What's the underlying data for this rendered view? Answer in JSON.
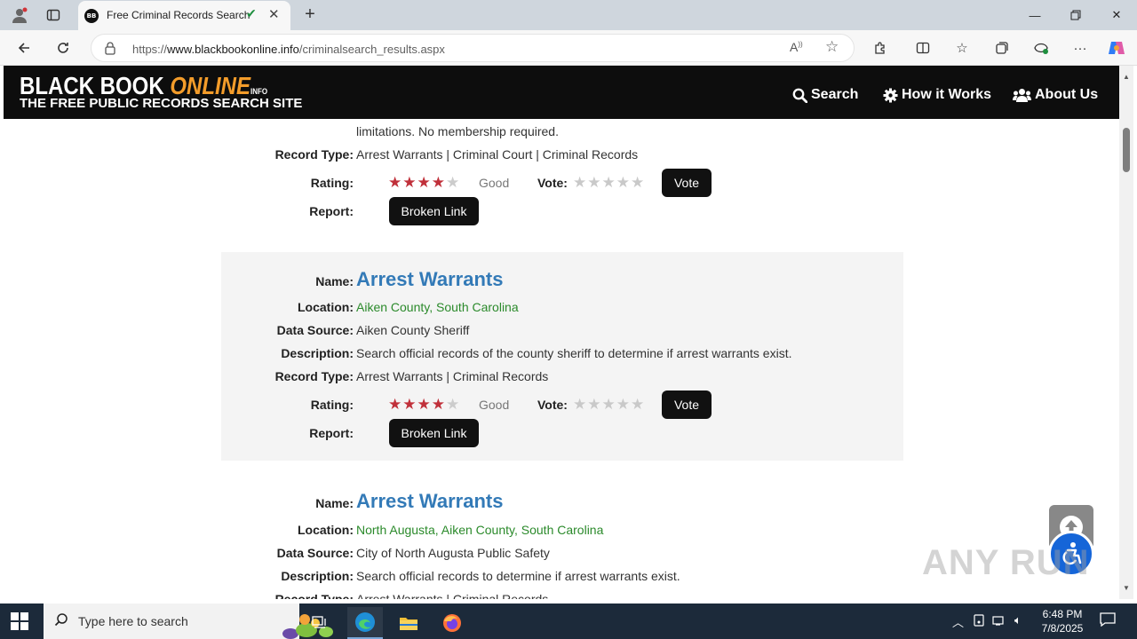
{
  "browser": {
    "tab_title": "Free Criminal Records Search",
    "tab_favicon_text": "BB",
    "url_prefix": "https://",
    "url_host": "www.blackbookonline.info",
    "url_path": "/criminalsearch_results.aspx"
  },
  "site": {
    "logo_black_book": "BLACK BOOK ",
    "logo_online": "ONLINE",
    "logo_info": "INFO",
    "tagline": "THE FREE PUBLIC RECORDS SEARCH SITE",
    "nav": [
      {
        "label": "Search",
        "icon": "search-icon"
      },
      {
        "label": "How it Works",
        "icon": "gear-icon"
      },
      {
        "label": "About Us",
        "icon": "users-icon"
      }
    ]
  },
  "labels": {
    "name": "Name:",
    "location": "Location:",
    "data_source": "Data Source:",
    "description": "Description:",
    "record_type": "Record Type:",
    "rating": "Rating:",
    "vote": "Vote:",
    "report": "Report:",
    "vote_button": "Vote",
    "broken_link_button": "Broken Link",
    "rating_word": "Good"
  },
  "records": [
    {
      "description_tail": "limitations. No membership required.",
      "record_type": "Arrest Warrants | Criminal Court | Criminal Records",
      "rating_stars": 4,
      "rating_word": "Good"
    },
    {
      "name": "Arrest Warrants",
      "location_parts": [
        "Aiken County",
        "South Carolina"
      ],
      "data_source": "Aiken County Sheriff",
      "description": "Search official records of the county sheriff to determine if arrest warrants exist.",
      "record_type": "Arrest Warrants | Criminal Records",
      "rating_stars": 4,
      "rating_word": "Good"
    },
    {
      "name": "Arrest Warrants",
      "location_parts": [
        "North Augusta",
        "Aiken County",
        "South Carolina"
      ],
      "data_source": "City of North Augusta Public Safety",
      "description": "Search official records to determine if arrest warrants exist.",
      "record_type": "Arrest Warrants | Criminal Records"
    }
  ],
  "overlay": {
    "watermark": "ANY RUN"
  },
  "taskbar": {
    "search_placeholder": "Type here to search",
    "time": "6:48 PM",
    "date": "7/8/2025"
  },
  "colors": {
    "header_bg": "#0d0d0d",
    "logo_accent": "#f39c2a",
    "link_blue": "#337ab7",
    "location_green": "#2b8a2b",
    "star_red": "#c0303a"
  }
}
